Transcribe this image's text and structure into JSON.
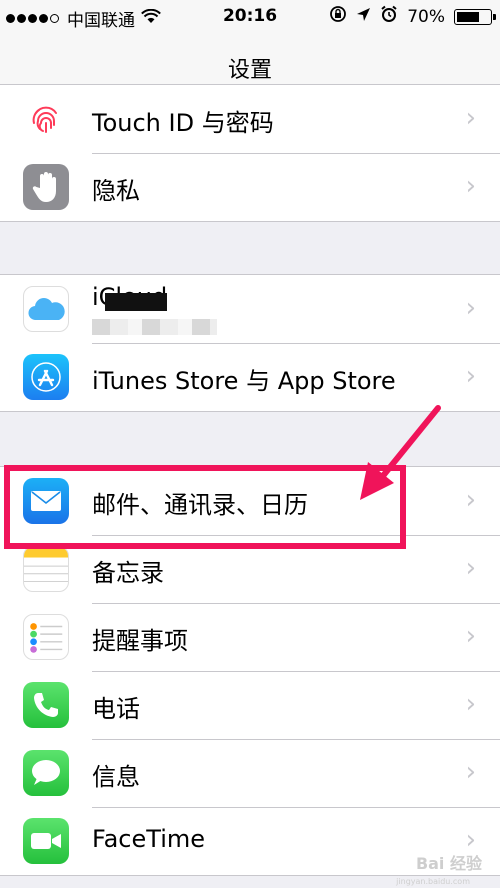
{
  "status_bar": {
    "carrier": "中国联通",
    "time": "20:16",
    "battery_percent": "70%",
    "battery_level": 0.7,
    "icons": [
      "wifi-icon",
      "rotation-lock-icon",
      "location-arrow-icon",
      "alarm-icon",
      "battery-icon"
    ]
  },
  "nav": {
    "title": "设置"
  },
  "groups": {
    "g1": [
      {
        "label": "Touch ID 与密码",
        "icon": "fingerprint-icon",
        "color": "#fe3b59"
      },
      {
        "label": "隐私",
        "icon": "hand-icon",
        "color": "#8e8e93"
      }
    ],
    "g2": [
      {
        "label": "iCloud",
        "icon": "icloud-icon",
        "color": "#4ab3f5"
      },
      {
        "label": "iTunes Store 与 App Store",
        "icon": "app-store-icon",
        "color": "#1c9ef0"
      }
    ],
    "g3": [
      {
        "label": "邮件、通讯录、日历",
        "icon": "mail-icon",
        "color": "#2a8df2"
      },
      {
        "label": "备忘录",
        "icon": "notes-icon",
        "color": "#fecb2f"
      },
      {
        "label": "提醒事项",
        "icon": "reminders-icon",
        "color": "#ffffff"
      },
      {
        "label": "电话",
        "icon": "phone-icon",
        "color": "#4cd964"
      },
      {
        "label": "信息",
        "icon": "messages-icon",
        "color": "#4cd964"
      },
      {
        "label": "FaceTime",
        "icon": "facetime-icon",
        "color": "#4cd964"
      }
    ]
  },
  "annotation": {
    "color": "#f0145a"
  },
  "watermark": {
    "text": "Bai 经验",
    "sub": "jingyan.baidu.com"
  }
}
